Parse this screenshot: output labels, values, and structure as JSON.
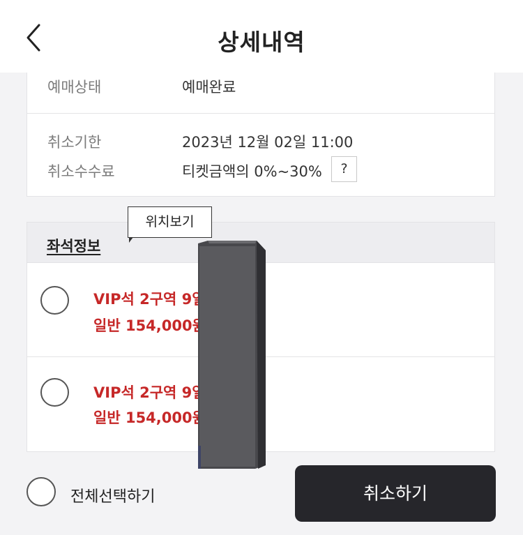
{
  "header": {
    "title": "상세내역",
    "back_icon": "chevron-left-icon"
  },
  "booking_info": {
    "status_label": "예매상태",
    "status_value": "예매완료",
    "cancel_deadline_label": "취소기한",
    "cancel_deadline_value": "2023년 12월 02일 11:00",
    "cancel_fee_label": "취소수수료",
    "cancel_fee_value": "티켓금액의 0%~30%",
    "help_label": "?"
  },
  "seat_info": {
    "title": "좌석정보",
    "tooltip": "위치보기",
    "seats": [
      {
        "name": "VIP석 2구역 9열",
        "price": "일반 154,000원",
        "selected": false
      },
      {
        "name": "VIP석 2구역 9열",
        "price": "일반 154,000원",
        "selected": false
      }
    ]
  },
  "footer": {
    "select_all_label": "전체선택하기",
    "cancel_button_label": "취소하기"
  },
  "colors": {
    "accent_red": "#c62828",
    "button_dark": "#26262b"
  }
}
